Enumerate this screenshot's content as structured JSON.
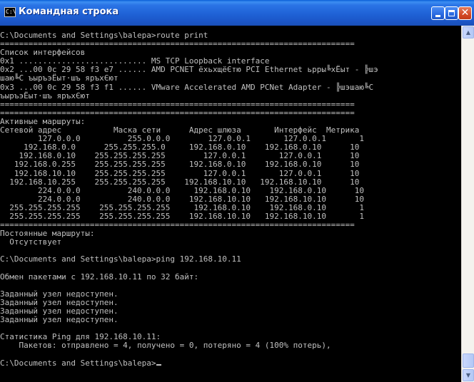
{
  "window": {
    "title": "Командная строка",
    "icon_label": "C:\\"
  },
  "console": {
    "text": "C:\\Documents and Settings\\balepa>route print\n===========================================================================\nСписок интерфейсов\n0x1 ........................... MS TCP Loopback interface\n0x2 ...00 0c 29 58 f3 e7 ...... AMD PCNET ёхьхщёЄтю PCI Ethernet ьрры╚хЁыт - ╠шэ\nшаю╚С ъыръэЁыт·шъ яръхЄют\n0x3 ...00 0c 29 58 f3 f1 ...... VMware Accelerated AMD PCNet Adapter - ╠шэшаю╚С\nъыръэЁыт·шъ яръхЄют\n===========================================================================\n===========================================================================\nАктивные маршруты:\nСетевой адрес           Маска сети      Адрес шлюза       Интерфейс  Метрика\n        127.0.0.0          255.0.0.0        127.0.0.1       127.0.0.1       1\n     192.168.0.0      255.255.255.0     192.168.0.10    192.168.0.10      10\n    192.168.0.10    255.255.255.255        127.0.0.1       127.0.0.1      10\n   192.168.0.255    255.255.255.255     192.168.0.10    192.168.0.10      10\n   192.168.10.10    255.255.255.255        127.0.0.1       127.0.0.1      10\n  192.168.10.255    255.255.255.255    192.168.10.10   192.168.10.10      10\n        224.0.0.0          240.0.0.0     192.168.0.10    192.168.0.10      10\n        224.0.0.0          240.0.0.0    192.168.10.10   192.168.10.10      10\n  255.255.255.255    255.255.255.255     192.168.0.10    192.168.0.10       1\n  255.255.255.255    255.255.255.255    192.168.10.10   192.168.10.10       1\n===========================================================================\nПостоянные маршруты:\n  Отсутствует\n\nC:\\Documents and Settings\\balepa>ping 192.168.10.11\n\nОбмен пакетами с 192.168.10.11 по 32 байт:\n\nЗаданный узел недоступен.\nЗаданный узел недоступен.\nЗаданный узел недоступен.\nЗаданный узел недоступен.\n\nСтатистика Ping для 192.168.10.11:\n    Пакетов: отправлено = 4, получено = 0, потеряно = 4 (100% потерь),\n\nC:\\Documents and Settings\\balepa>"
  },
  "colors": {
    "titlebar": "#2a74e6",
    "console_bg": "#000000",
    "console_text": "#c0c0c0"
  },
  "icons": {
    "window_icon": "cmd-icon",
    "minimize": "minimize-icon",
    "maximize": "maximize-icon",
    "close": "close-icon",
    "scroll_up": "scroll-up-arrow-icon",
    "scroll_down": "scroll-down-arrow-icon"
  }
}
